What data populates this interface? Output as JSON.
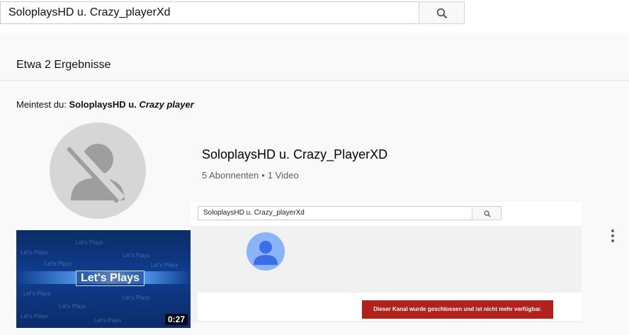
{
  "search": {
    "query": "SoloplaysHD u. Crazy_playerXd",
    "button_icon": "search-icon"
  },
  "results": {
    "count_label": "Etwa 2 Ergebnisse"
  },
  "suggestion": {
    "prefix": "Meintest du:",
    "bold": "SoloplaysHD u.",
    "italic": "Crazy player"
  },
  "channel": {
    "name": "SoloplaysHD u. Crazy_PlayerXD",
    "subscribers": "5 Abonnenten",
    "separator": "•",
    "videos": "1 Video",
    "avatar_icon": "no-avatar-icon",
    "menu_icon": "more-vert-icon"
  },
  "video": {
    "thumbnail_title": "Let's Plays",
    "duration": "0:27"
  },
  "embed": {
    "search_query": "SoloplaysHD u. Crazy_playerXd",
    "error_message": "Dieser Kanal wurde geschlossen und ist nicht mehr verfügbar."
  },
  "colors": {
    "error_red": "#b3211a",
    "avatar_blue": "#8ab4f8"
  }
}
